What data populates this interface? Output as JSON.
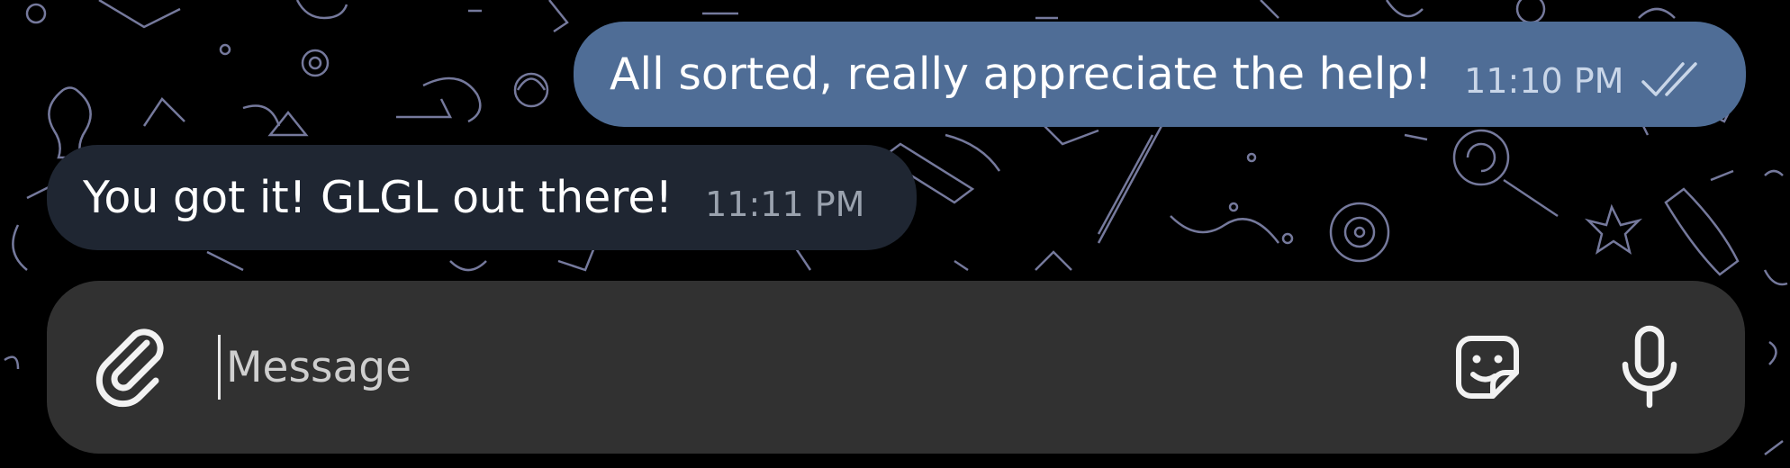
{
  "chat": {
    "messages": [
      {
        "direction": "outgoing",
        "text": "All sorted, really appreciate the help!",
        "time": "11:10 PM",
        "status": "read",
        "bubble_color": "#4f6d96"
      },
      {
        "direction": "incoming",
        "text": "You got it! GLGL out there!",
        "time": "11:11 PM",
        "bubble_color": "#1f2632"
      }
    ],
    "background_color": "#000000"
  },
  "composer": {
    "placeholder": "Message",
    "attach_icon": "paperclip-icon",
    "sticker_icon": "sticker-icon",
    "voice_icon": "microphone-icon",
    "background_color": "#313131"
  }
}
